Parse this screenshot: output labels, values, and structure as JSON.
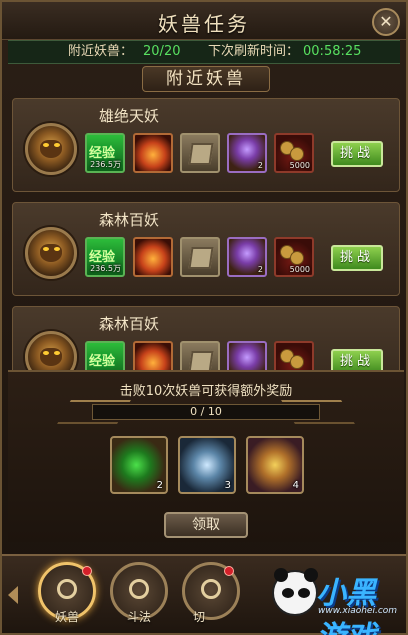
{
  "header": {
    "title": "妖兽任务",
    "close_label": "✕"
  },
  "info": {
    "nearby_label": "附近妖兽：",
    "nearby_value": "20/20",
    "refresh_label": "下次刷新时间：",
    "refresh_value": "00:58:25"
  },
  "section_title": "附近妖兽",
  "tasks": [
    {
      "name": "雄绝天妖",
      "rewards": [
        {
          "icon": "exp-icon",
          "label": "经验",
          "count": "236.5万"
        },
        {
          "icon": "fire-crystal-icon",
          "count": ""
        },
        {
          "icon": "stone-box-icon",
          "count": ""
        },
        {
          "icon": "gem-chest-icon",
          "count": "2"
        },
        {
          "icon": "copper-coins-icon",
          "count": "5000"
        }
      ],
      "button": "挑战"
    },
    {
      "name": "森林百妖",
      "rewards": [
        {
          "icon": "exp-icon",
          "label": "经验",
          "count": "236.5万"
        },
        {
          "icon": "fire-crystal-icon",
          "count": ""
        },
        {
          "icon": "stone-box-icon",
          "count": ""
        },
        {
          "icon": "gem-chest-icon",
          "count": "2"
        },
        {
          "icon": "copper-coins-icon",
          "count": "5000"
        }
      ],
      "button": "挑战"
    },
    {
      "name": "森林百妖",
      "rewards": [
        {
          "icon": "exp-icon",
          "label": "经验",
          "count": ""
        },
        {
          "icon": "fire-crystal-icon",
          "count": ""
        },
        {
          "icon": "stone-box-icon",
          "count": ""
        },
        {
          "icon": "gem-chest-icon",
          "count": ""
        },
        {
          "icon": "copper-coins-icon",
          "count": ""
        }
      ],
      "button": "挑战"
    }
  ],
  "bonus": {
    "title": "击败10次妖兽可获得额外奖励",
    "progress_text": "0 / 10",
    "progress_fraction": 0,
    "prizes": [
      {
        "icon": "green-gem-icon",
        "count": "2"
      },
      {
        "icon": "blue-rune-stone-icon",
        "count": "3"
      },
      {
        "icon": "gold-token-icon",
        "count": "4"
      }
    ],
    "claim_label": "领取"
  },
  "nav": {
    "items": [
      {
        "label": "妖兽",
        "active": true
      },
      {
        "label": "斗法",
        "active": false
      },
      {
        "label": "切",
        "active": false
      }
    ]
  },
  "watermark": {
    "main": "小黑游戏",
    "url": "www.xiaohei.com"
  },
  "colors": {
    "accent_green": "#58e060",
    "button_green": "#8ed04e",
    "progress_fill": "#e0a23c"
  }
}
